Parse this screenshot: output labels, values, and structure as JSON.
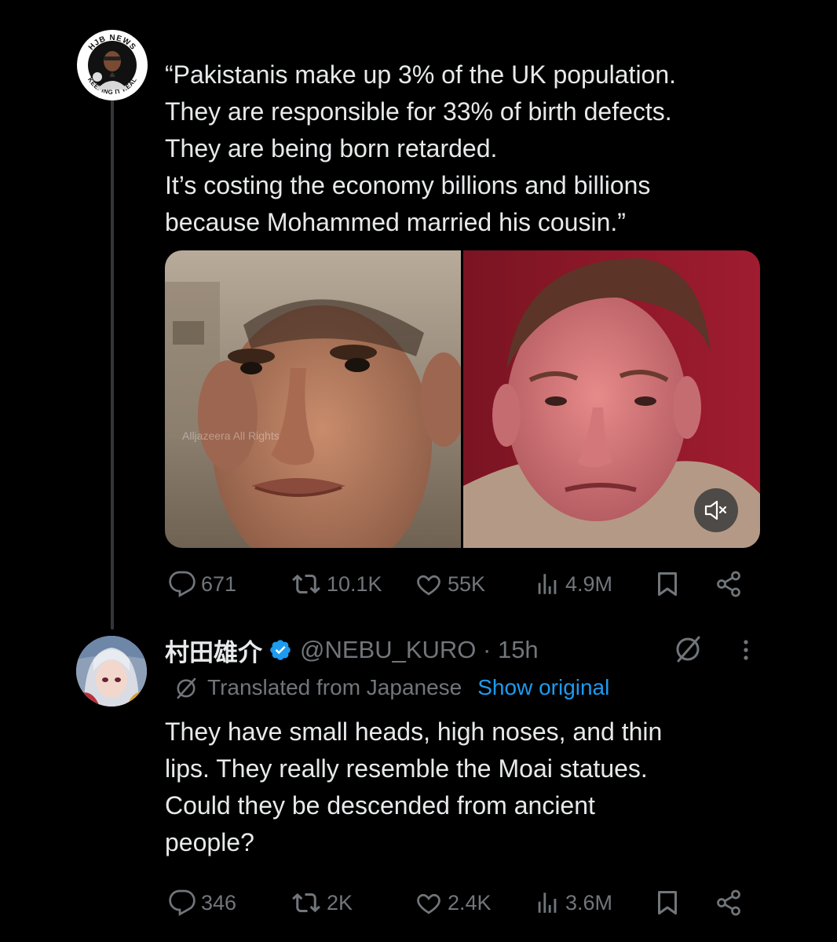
{
  "tweet1": {
    "avatar_text_top": "HJB NEWS",
    "avatar_text_bottom": "KEEPING IT REAL",
    "text": "“Pakistanis make up 3% of the UK population.\nThey are responsible for 33% of birth defects.\nThey are being born retarded.\nIt’s costing the economy billions and billions\nbecause Mohammed married his cousin.”",
    "media_watermark": "Alljazeera All Rights",
    "stats": {
      "replies": "671",
      "reposts": "10.1K",
      "likes": "55K",
      "views": "4.9M"
    }
  },
  "tweet2": {
    "display_name": "村田雄介",
    "handle_time": "@NEBU_KURO · 15h",
    "translated_label": "Translated from Japanese",
    "show_original": "Show original",
    "text": "They have small heads, high noses, and thin\nlips. They really resemble the Moai statues.\nCould they be descended from ancient\npeople?",
    "stats": {
      "replies": "346",
      "reposts": "2K",
      "likes": "2.4K",
      "views": "3.6M"
    }
  },
  "colors": {
    "background": "#000000",
    "text": "#e7e9ea",
    "muted": "#71767b",
    "link": "#1d9bf0",
    "verified": "#1d9bf0"
  },
  "icons": [
    "reply-icon",
    "repost-icon",
    "like-icon",
    "views-icon",
    "bookmark-icon",
    "share-icon",
    "verified-badge-icon",
    "grok-icon",
    "more-icon",
    "translate-icon",
    "mute-icon"
  ]
}
